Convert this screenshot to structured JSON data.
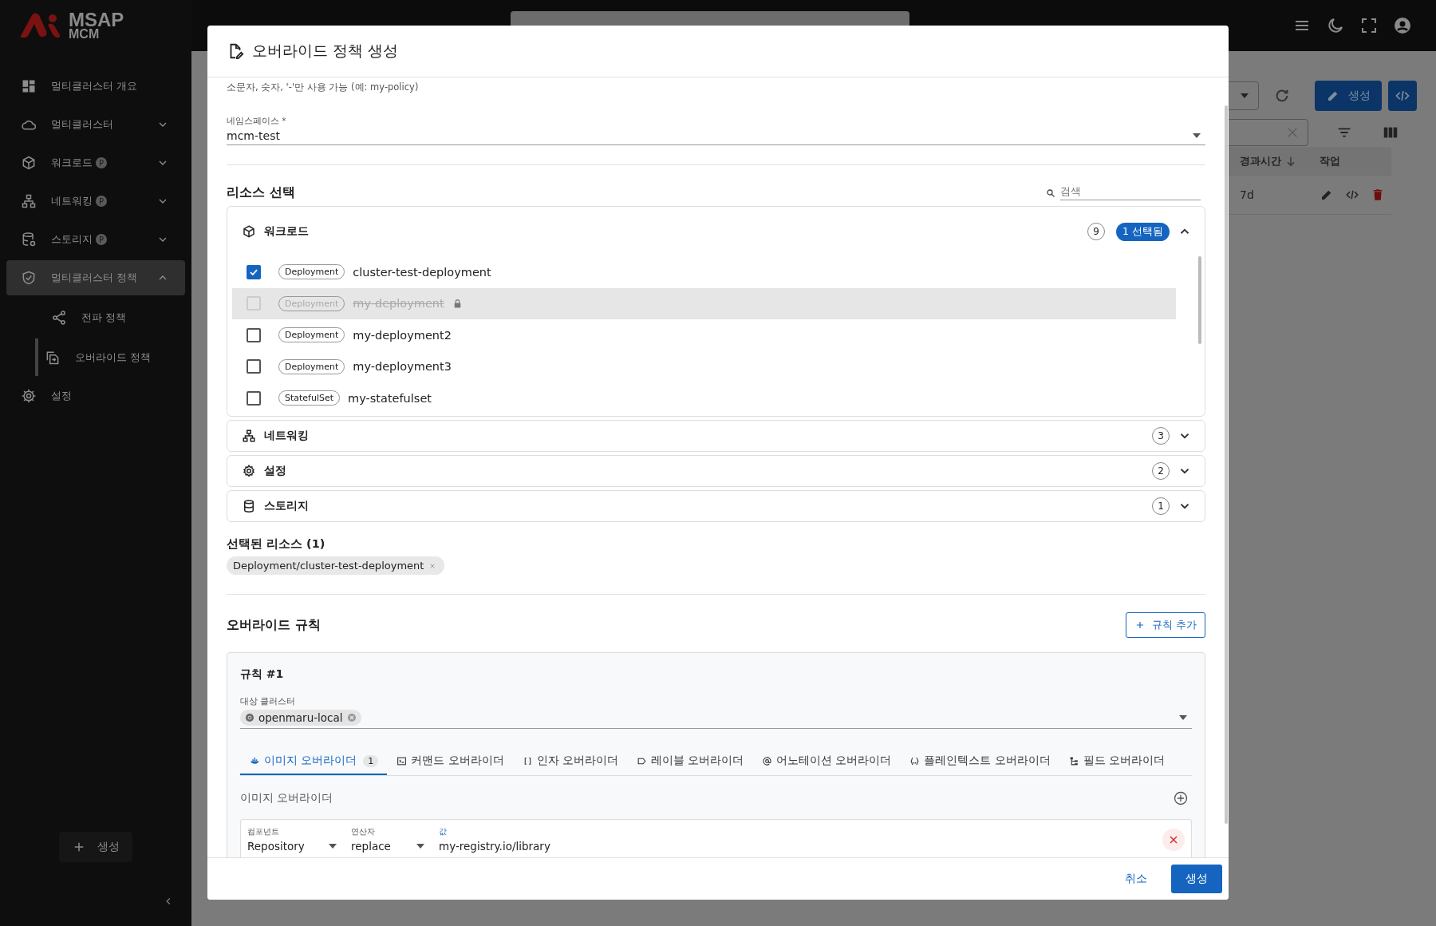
{
  "brand": {
    "title": "MSAP",
    "subtitle": "MCM"
  },
  "sidebar": {
    "items": [
      {
        "label": "멀티클러스터 개요",
        "kind": "link",
        "selected": false
      },
      {
        "label": "멀티클러스터",
        "kind": "group",
        "expanded": false,
        "selected": false
      },
      {
        "label": "워크로드",
        "badge": "P",
        "kind": "group",
        "expanded": false,
        "selected": false
      },
      {
        "label": "네트워킹",
        "badge": "P",
        "kind": "group",
        "expanded": false,
        "selected": false
      },
      {
        "label": "스토리지",
        "badge": "P",
        "kind": "group",
        "expanded": false,
        "selected": false
      },
      {
        "label": "멀티클러스터 정책",
        "kind": "group",
        "expanded": true,
        "selected": true,
        "children": [
          {
            "label": "전파 정책",
            "selected": false
          },
          {
            "label": "오버라이드 정책",
            "selected": true
          }
        ]
      },
      {
        "label": "설정",
        "kind": "link",
        "selected": false
      }
    ],
    "create_button": "생성"
  },
  "page": {
    "create_button": "생성",
    "table": {
      "columns": [
        "경과시간",
        "작업"
      ],
      "rows": [
        {
          "age": "7d"
        }
      ]
    }
  },
  "dialog": {
    "title": "오버라이드 정책 생성",
    "name_hint": "소문자, 숫자, '-'만 사용 가능 (예: my-policy)",
    "namespace": {
      "label": "네임스페이스 *",
      "value": "mcm-test"
    },
    "resources": {
      "title": "리소스 선택",
      "search_placeholder": "검색",
      "groups": [
        {
          "name": "워크로드",
          "count": "9",
          "selected_badge": "1 선택됨",
          "expanded": true,
          "items": [
            {
              "type": "Deployment",
              "name": "cluster-test-deployment",
              "checked": true,
              "disabled": false
            },
            {
              "type": "Deployment",
              "name": "my-deployment",
              "checked": false,
              "disabled": true
            },
            {
              "type": "Deployment",
              "name": "my-deployment2",
              "checked": false,
              "disabled": false
            },
            {
              "type": "Deployment",
              "name": "my-deployment3",
              "checked": false,
              "disabled": false
            },
            {
              "type": "StatefulSet",
              "name": "my-statefulset",
              "checked": false,
              "disabled": false
            }
          ]
        },
        {
          "name": "네트워킹",
          "count": "3",
          "expanded": false
        },
        {
          "name": "설정",
          "count": "2",
          "expanded": false
        },
        {
          "name": "스토리지",
          "count": "1",
          "expanded": false
        }
      ]
    },
    "selected": {
      "title": "선택된 리소스 (1)",
      "chips": [
        "Deployment/cluster-test-deployment"
      ]
    },
    "rules": {
      "title": "오버라이드 규칙",
      "add_button": "규칙 추가",
      "items": [
        {
          "title": "규칙 #1",
          "cluster_label": "대상 클러스터",
          "clusters": [
            "openmaru-local"
          ],
          "tabs": [
            {
              "label": "이미지 오버라이더",
              "count": "1",
              "selected": true
            },
            {
              "label": "커맨드 오버라이더",
              "selected": false
            },
            {
              "label": "인자 오버라이더",
              "selected": false
            },
            {
              "label": "레이블 오버라이더",
              "selected": false
            },
            {
              "label": "어노테이션 오버라이더",
              "selected": false
            },
            {
              "label": "플레인텍스트 오버라이더",
              "selected": false
            },
            {
              "label": "필드 오버라이더",
              "selected": false
            }
          ],
          "section_title": "이미지 오버라이더",
          "overrides": [
            {
              "component_label": "컴포넌트",
              "component": "Repository",
              "operator_label": "연산자",
              "operator": "replace",
              "value_label": "값",
              "value": "my-registry.io/library"
            }
          ]
        }
      ]
    },
    "cancel_button": "취소",
    "submit_button": "생성"
  }
}
